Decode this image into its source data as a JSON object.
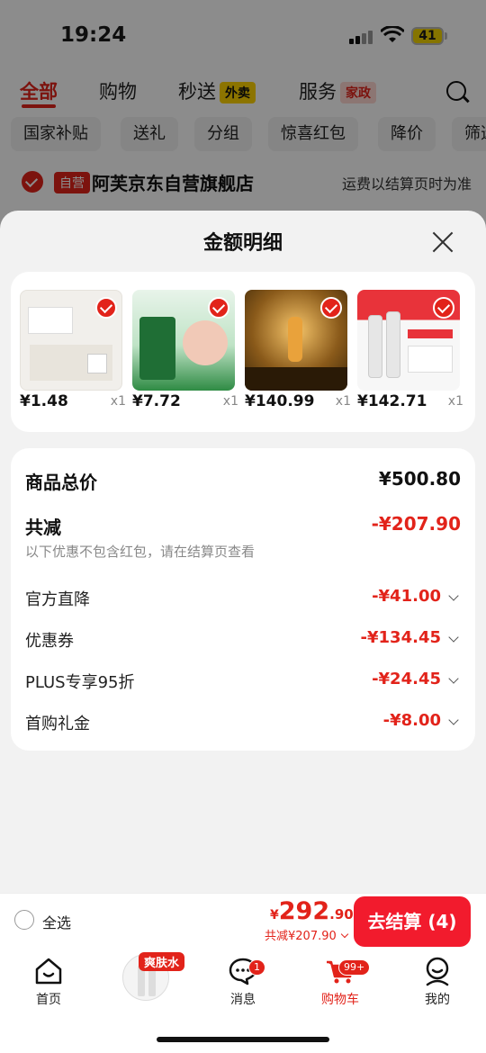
{
  "status_bar": {
    "time": "19:24",
    "battery": "41"
  },
  "top_tabs": [
    {
      "label": "全部",
      "active": true
    },
    {
      "label": "购物",
      "active": false
    },
    {
      "label": "秒送",
      "badge": "外卖",
      "active": false
    },
    {
      "label": "服务",
      "badge": "家政",
      "active": false
    }
  ],
  "chips": [
    "国家补贴",
    "送礼",
    "分组",
    "惊喜红包",
    "降价",
    "筛选"
  ],
  "store": {
    "badge": "自营",
    "name": "阿芙京东自营旗舰店",
    "shipping_note": "运费以结算页时为准"
  },
  "sheet": {
    "title": "金额明细",
    "products": [
      {
        "price": "¥1.48",
        "qty": "x1"
      },
      {
        "price": "¥7.72",
        "qty": "x1"
      },
      {
        "price": "¥140.99",
        "qty": "x1"
      },
      {
        "price": "¥142.71",
        "qty": "x1"
      }
    ],
    "summary": {
      "total_label": "商品总价",
      "total_value": "¥500.80",
      "discount_label": "共减",
      "discount_value": "-¥207.90",
      "note": "以下优惠不包含红包，请在结算页查看",
      "items": [
        {
          "label": "官方直降",
          "value": "-¥41.00"
        },
        {
          "label": "优惠券",
          "value": "-¥134.45"
        },
        {
          "label": "PLUS专享95折",
          "value": "-¥24.45"
        },
        {
          "label": "首购礼金",
          "value": "-¥8.00"
        }
      ]
    }
  },
  "action_bar": {
    "select_all": "全选",
    "price_symbol": "¥",
    "price_int": "292",
    "price_dec": ".90",
    "total_discount": "共减¥207.90",
    "checkout": "去结算 (4)"
  },
  "bottom_nav": {
    "items": [
      {
        "label": "首页"
      },
      {
        "label": "消息",
        "badge": "1"
      },
      {
        "label": "购物车",
        "badge": "99+",
        "active": true
      },
      {
        "label": "我的"
      }
    ],
    "promo_tag": "爽肤水"
  },
  "colors": {
    "accent": "#e2231a",
    "checkout": "#f21b2d"
  }
}
